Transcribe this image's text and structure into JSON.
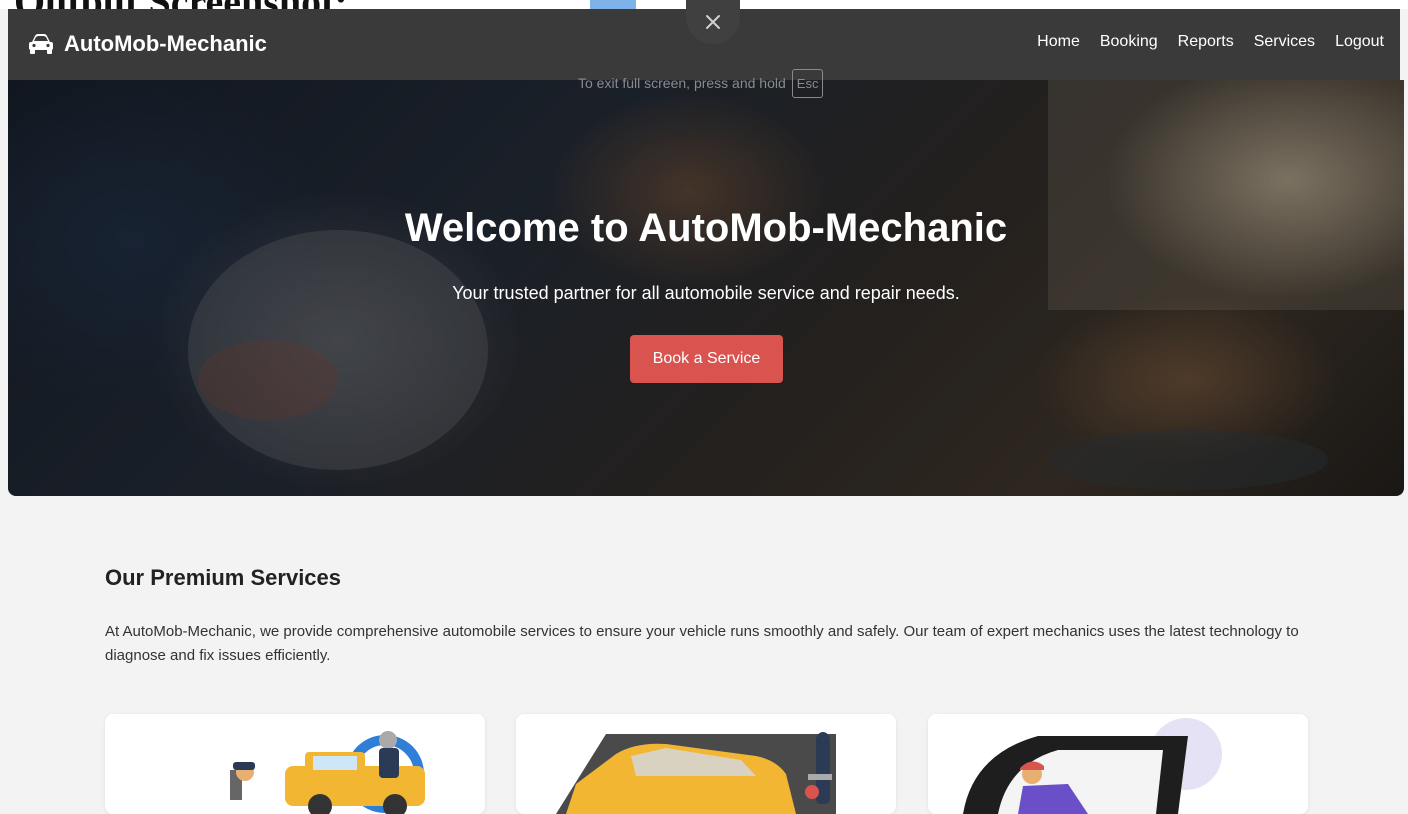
{
  "page_caption": "Output Screenshot:",
  "brand": {
    "name": "AutoMob-Mechanic",
    "icon": "car-icon"
  },
  "nav": {
    "items": [
      {
        "label": "Home"
      },
      {
        "label": "Booking"
      },
      {
        "label": "Reports"
      },
      {
        "label": "Services"
      },
      {
        "label": "Logout"
      }
    ]
  },
  "fullscreen": {
    "close_icon": "close-icon",
    "hint": "To exit full screen, press and hold",
    "key": "Esc"
  },
  "hero": {
    "title": "Welcome to AutoMob-Mechanic",
    "subtitle": "Your trusted partner for all automobile service and repair needs.",
    "button_label": "Book a Service"
  },
  "services": {
    "title": "Our Premium Services",
    "description": "At AutoMob-Mechanic, we provide comprehensive automobile services to ensure your vehicle runs smoothly and safely. Our team of expert mechanics uses the latest technology to diagnose and fix issues efficiently.",
    "cards": [
      {
        "image": "tow-truck-illustration"
      },
      {
        "image": "car-repair-illustration"
      },
      {
        "image": "driver-illustration"
      }
    ]
  },
  "colors": {
    "navbar_bg": "#3a3a3a",
    "accent_button": "#d9534f",
    "page_bg": "#f3f3f3"
  }
}
